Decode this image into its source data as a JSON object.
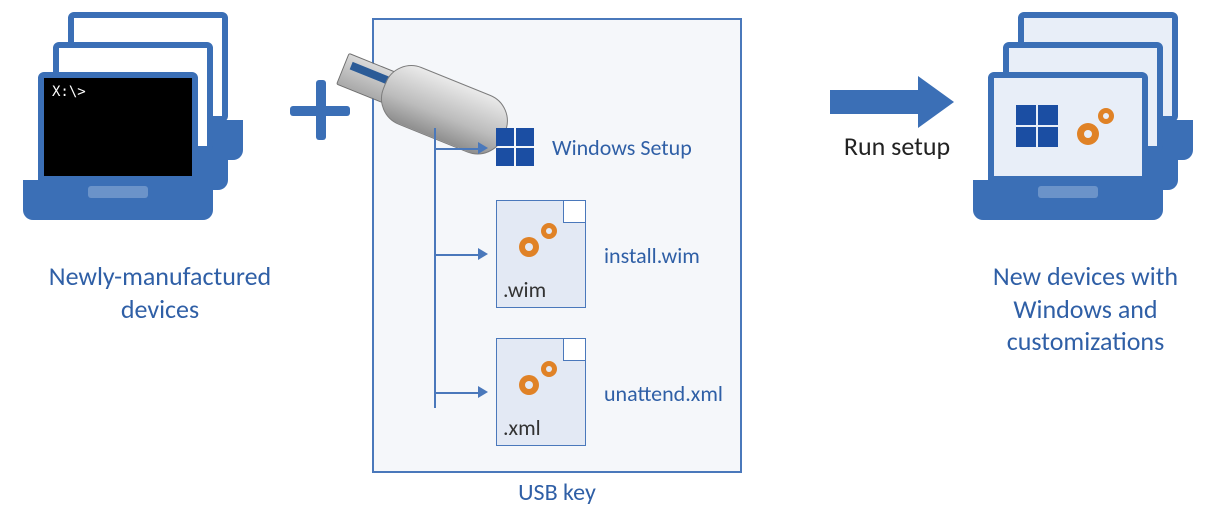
{
  "left_laptops": {
    "prompt": "X:\\>",
    "caption": "Newly-manufactured devices"
  },
  "plus": {
    "symbol": "+"
  },
  "usb": {
    "caption": "USB key",
    "items": [
      {
        "label": "Windows Setup",
        "ext": ""
      },
      {
        "label": "install.wim",
        "ext": ".wim"
      },
      {
        "label": "unattend.xml",
        "ext": ".xml"
      }
    ]
  },
  "run_setup": "Run setup",
  "right_laptops": {
    "caption": "New devices with Windows and customizations"
  }
}
